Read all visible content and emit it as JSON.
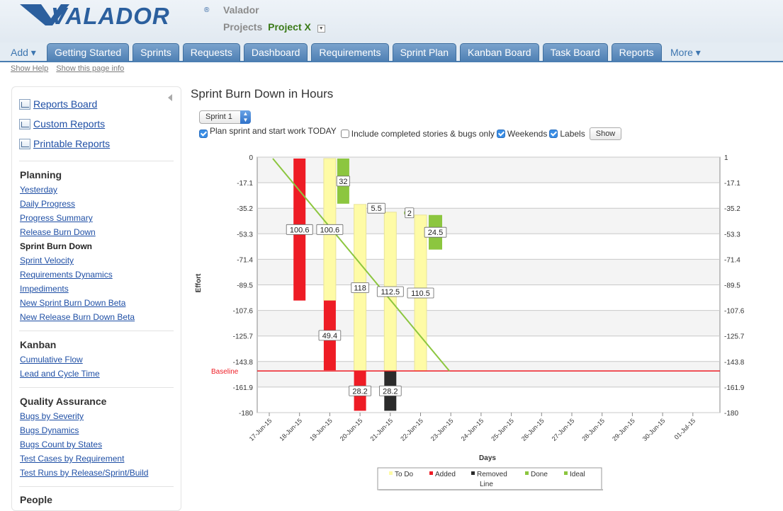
{
  "app": {
    "logo_text": "VALADOR",
    "org_name": "Valador",
    "projects_label": "Projects",
    "project_name": "Project X"
  },
  "nav": {
    "add_label": "Add ▾",
    "tabs": [
      "Getting Started",
      "Sprints",
      "Requests",
      "Dashboard",
      "Requirements",
      "Sprint Plan",
      "Kanban Board",
      "Task Board",
      "Reports"
    ],
    "more_label": "More ▾"
  },
  "help": {
    "show_help": "Show Help",
    "show_page_info": "Show this page info"
  },
  "sidebar": {
    "report_links": [
      "Reports Board",
      "Custom Reports",
      "Printable Reports"
    ],
    "sections": [
      {
        "title": "Planning",
        "items": [
          "Yesterday",
          "Daily Progress",
          "Progress Summary",
          "Release Burn Down",
          "Sprint Burn Down",
          "Sprint Velocity",
          "Requirements Dynamics",
          "Impediments",
          "New Sprint Burn Down Beta",
          "New Release Burn Down Beta"
        ],
        "current": "Sprint Burn Down"
      },
      {
        "title": "Kanban",
        "items": [
          "Cumulative Flow",
          "Lead and Cycle Time"
        ]
      },
      {
        "title": "Quality Assurance",
        "items": [
          "Bugs by Severity",
          "Bugs Dynamics",
          "Bugs Count by States",
          "Test Cases by Requirement",
          "Test Runs by Release/Sprint/Build"
        ]
      },
      {
        "title": "People",
        "items": []
      }
    ]
  },
  "main": {
    "title": "Sprint Burn Down in Hours",
    "sprint_select": "Sprint 1",
    "options": [
      {
        "label": "Plan sprint and start work TODAY",
        "checked": true
      },
      {
        "label": "Include completed stories & bugs only",
        "checked": false
      },
      {
        "label": "Weekends",
        "checked": true
      },
      {
        "label": "Labels",
        "checked": true
      }
    ],
    "show_button": "Show"
  },
  "colors": {
    "todo": "#fefba6",
    "added": "#ee1c25",
    "removed": "#2b2b2b",
    "done": "#8cc63f",
    "ideal": "#8cc63f",
    "baseline": "#ee1c25",
    "tab": "#5b89ba"
  },
  "chart_data": {
    "type": "bar",
    "subtype": "waterfall",
    "xlabel": "Days",
    "ylabel": "Effort",
    "y_ticks_left": [
      "0",
      "-17.1",
      "-35.2",
      "-53.3",
      "-71.4",
      "-89.5",
      "-107.6",
      "-125.7",
      "-143.8",
      "-161.9",
      "-180"
    ],
    "y_ticks_right": [
      "1",
      "-17.1",
      "-35.2",
      "-53.3",
      "-71.4",
      "-89.5",
      "-107.6",
      "-125.7",
      "-143.8",
      "-161.9",
      "-180"
    ],
    "ylim": [
      -180,
      1
    ],
    "categories": [
      "17-Jun-15",
      "18-Jun-15",
      "19-Jun-15",
      "20-Jun-15",
      "21-Jun-15",
      "22-Jun-15",
      "23-Jun-15",
      "24-Jun-15",
      "25-Jun-15",
      "26-Jun-15",
      "27-Jun-15",
      "28-Jun-15",
      "29-Jun-15",
      "30-Jun-15",
      "01-Jul-15"
    ],
    "baseline": {
      "label": "Baseline",
      "value": -150.5
    },
    "bars": [
      {
        "category": "18-Jun-15",
        "series": "Added",
        "from": 0,
        "to": -100.6,
        "label": "100.6"
      },
      {
        "category": "19-Jun-15",
        "series": "To Do",
        "from": 0,
        "to": -100.6,
        "label": "100.6"
      },
      {
        "category": "19-Jun-15",
        "series": "Added",
        "from": -100.6,
        "to": -150.0,
        "label": "49.4"
      },
      {
        "category": "19-Jun-15",
        "series": "Done",
        "from": 0,
        "to": -32,
        "label": "32"
      },
      {
        "category": "20-Jun-15",
        "series": "To Do",
        "from": -32.5,
        "to": -150.5,
        "label": "118"
      },
      {
        "category": "20-Jun-15",
        "series": "Added",
        "from": -150.5,
        "to": -178.7,
        "label": "28.2"
      },
      {
        "category": "20-Jun-15",
        "series": "Done",
        "from": -32,
        "to": -37.5,
        "label": "5.5"
      },
      {
        "category": "21-Jun-15",
        "series": "To Do",
        "from": -38,
        "to": -150.5,
        "label": "112.5"
      },
      {
        "category": "21-Jun-15",
        "series": "Removed",
        "from": -150.5,
        "to": -178.7,
        "label": "28.2"
      },
      {
        "category": "21-Jun-15",
        "series": "Done",
        "from": -37.5,
        "to": -39.5,
        "label": "2"
      },
      {
        "category": "22-Jun-15",
        "series": "To Do",
        "from": -40,
        "to": -150.5,
        "label": "110.5"
      },
      {
        "category": "22-Jun-15",
        "series": "Done",
        "from": -40,
        "to": -64.5,
        "label": "24.5"
      }
    ],
    "ideal_line": {
      "series": "Ideal",
      "from": {
        "x": "17-Jun-15",
        "y": 0
      },
      "to": {
        "x": "23-Jun-15",
        "y": -150.5
      }
    },
    "legend": [
      "To Do",
      "Added",
      "Removed",
      "Done",
      "Ideal Line"
    ],
    "legend_position": "bottom",
    "grid": true
  }
}
